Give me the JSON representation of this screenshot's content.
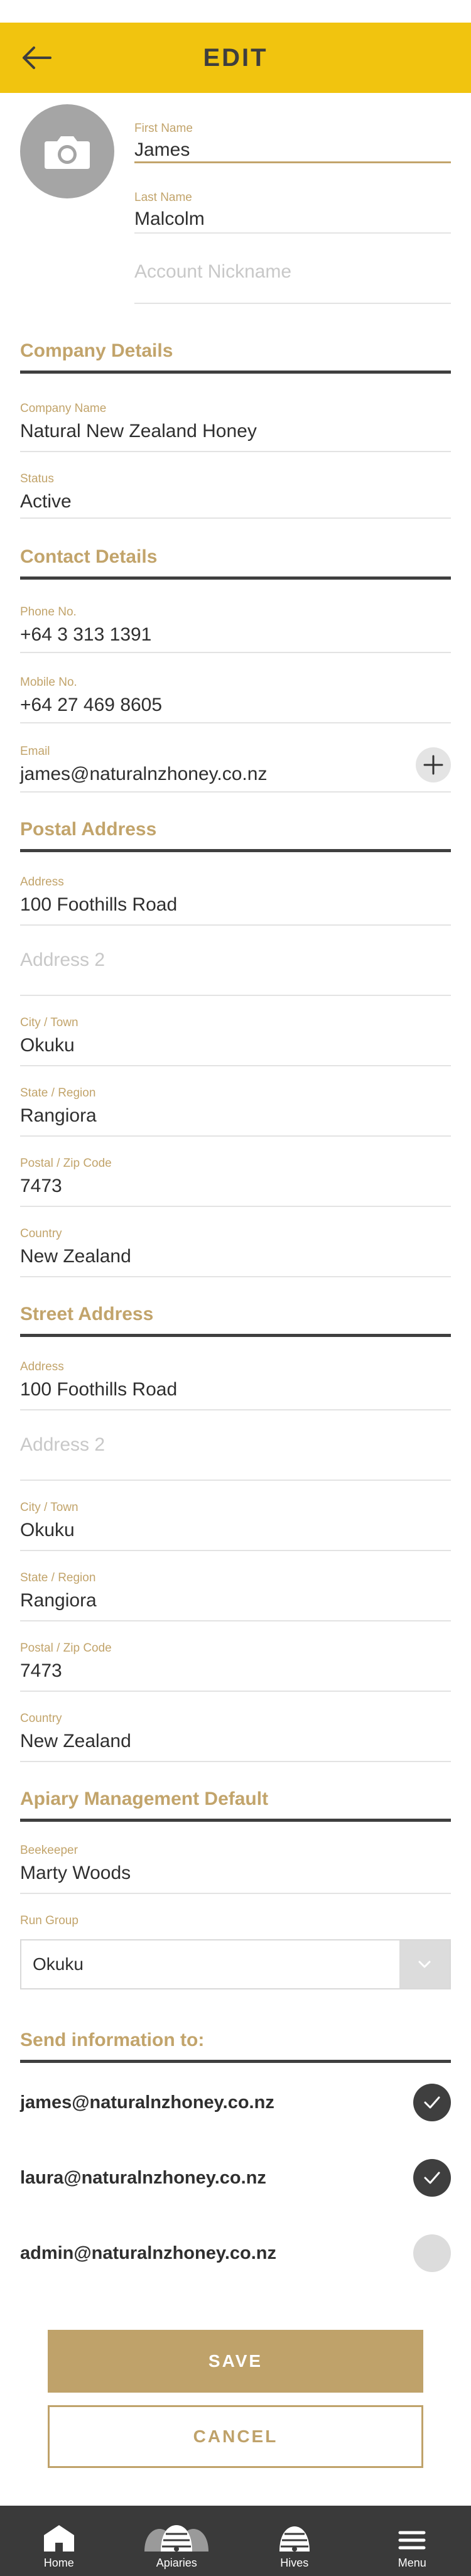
{
  "header": {
    "title": "EDIT"
  },
  "profile": {
    "first_name": {
      "label": "First Name",
      "value": "James"
    },
    "last_name": {
      "label": "Last Name",
      "value": "Malcolm"
    },
    "nickname": {
      "placeholder": "Account Nickname"
    }
  },
  "company": {
    "title": "Company Details",
    "name": {
      "label": "Company Name",
      "value": "Natural New Zealand Honey"
    },
    "status": {
      "label": "Status",
      "value": "Active"
    }
  },
  "contact": {
    "title": "Contact Details",
    "phone": {
      "label": "Phone No.",
      "value": "+64 3 313 1391"
    },
    "mobile": {
      "label": "Mobile No.",
      "value": "+64 27 469 8605"
    },
    "email": {
      "label": "Email",
      "value": "james@naturalnzhoney.co.nz"
    }
  },
  "postal": {
    "title": "Postal Address",
    "address": {
      "label": "Address",
      "value": "100 Foothills Road"
    },
    "address2": {
      "placeholder": "Address 2"
    },
    "city": {
      "label": "City / Town",
      "value": "Okuku"
    },
    "state": {
      "label": "State / Region",
      "value": "Rangiora"
    },
    "zip": {
      "label": "Postal / Zip Code",
      "value": "7473"
    },
    "country": {
      "label": "Country",
      "value": "New Zealand"
    }
  },
  "street": {
    "title": "Street Address",
    "address": {
      "label": "Address",
      "value": "100 Foothills Road"
    },
    "address2": {
      "placeholder": "Address 2"
    },
    "city": {
      "label": "City / Town",
      "value": "Okuku"
    },
    "state": {
      "label": "State / Region",
      "value": "Rangiora"
    },
    "zip": {
      "label": "Postal / Zip Code",
      "value": "7473"
    },
    "country": {
      "label": "Country",
      "value": "New Zealand"
    }
  },
  "apiary": {
    "title": "Apiary Management Default",
    "beekeeper": {
      "label": "Beekeeper",
      "value": "Marty Woods"
    },
    "run_group": {
      "label": "Run Group",
      "value": "Okuku"
    }
  },
  "send_info": {
    "title": "Send information to:",
    "recipients": [
      {
        "email": "james@naturalnzhoney.co.nz",
        "checked": true
      },
      {
        "email": "laura@naturalnzhoney.co.nz",
        "checked": true
      },
      {
        "email": "admin@naturalnzhoney.co.nz",
        "checked": false
      }
    ]
  },
  "actions": {
    "save": "SAVE",
    "cancel": "CANCEL"
  },
  "tabbar": {
    "home": "Home",
    "apiaries": "Apiaries",
    "hives": "Hives",
    "menu": "Menu"
  },
  "colors": {
    "header_bg": "#f1c40f",
    "accent_gold": "#c2a46b",
    "tabbar_bg": "#3a3a3a",
    "dark_text": "#3e3e3e"
  },
  "icons": [
    "back-arrow-icon",
    "camera-icon",
    "plus-icon",
    "chevron-down-icon",
    "check-icon",
    "home-icon",
    "beehives-icon",
    "hive-icon",
    "hamburger-menu-icon"
  ]
}
